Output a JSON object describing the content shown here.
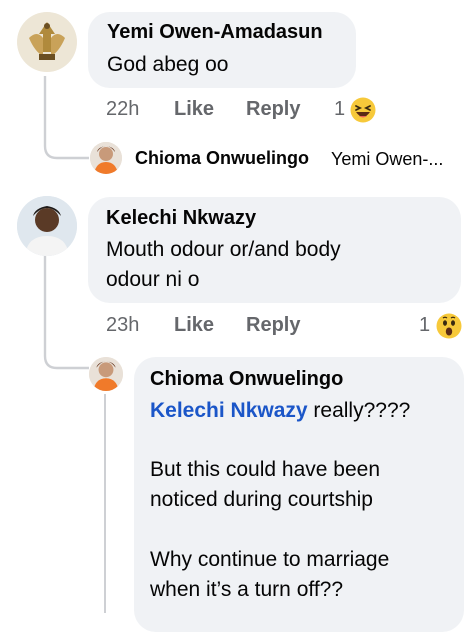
{
  "comments": [
    {
      "author": "Yemi Owen-Amadasun",
      "text": "God abeg oo",
      "time": "22h",
      "like_label": "Like",
      "reply_label": "Reply",
      "reaction_count": "1",
      "reaction_icon": "laughing-emoji-icon",
      "collapsed_reply": {
        "author": "Chioma Onwuelingo",
        "preview": "Yemi Owen-..."
      }
    },
    {
      "author": "Kelechi Nkwazy",
      "text": "Mouth odour or/and body\nodour ni o",
      "time": "23h",
      "like_label": "Like",
      "reply_label": "Reply",
      "reaction_count": "1",
      "reaction_icon": "wow-emoji-icon",
      "reply": {
        "author": "Chioma Onwuelingo",
        "mention": "Kelechi Nkwazy",
        "text_after_mention": " really????",
        "paragraph_2": "But this could have been\nnoticed during courtship",
        "paragraph_3": "Why continue to marriage\nwhen it’s a turn off??"
      }
    }
  ],
  "colors": {
    "bubble": "#f0f2f5",
    "meta_text": "#65676b",
    "mention": "#1b56c8",
    "thread_line": "#ced0d4"
  }
}
